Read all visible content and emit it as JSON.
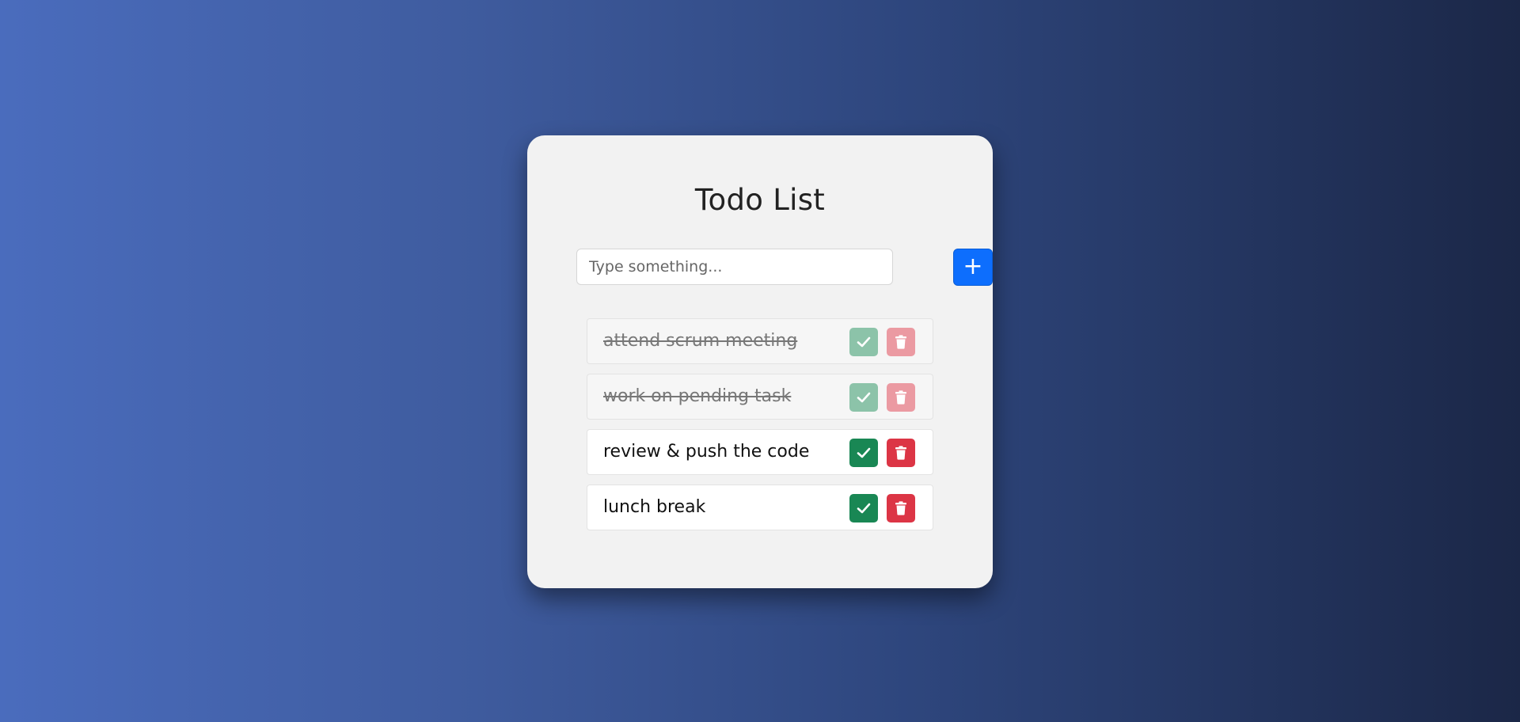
{
  "app": {
    "title": "Todo List"
  },
  "input": {
    "placeholder": "Type something...",
    "value": ""
  },
  "add_button": {
    "label": "+",
    "icon": "plus-icon",
    "color": "#0d6efd"
  },
  "todos": [
    {
      "text": "attend scrum meeting",
      "completed": true
    },
    {
      "text": "work on pending task",
      "completed": true
    },
    {
      "text": "review & push the code",
      "completed": false
    },
    {
      "text": "lunch break",
      "completed": false
    }
  ],
  "item_actions": {
    "complete_icon": "check-icon",
    "delete_icon": "trash-icon",
    "complete_color": "#198754",
    "delete_color": "#dc3545"
  }
}
